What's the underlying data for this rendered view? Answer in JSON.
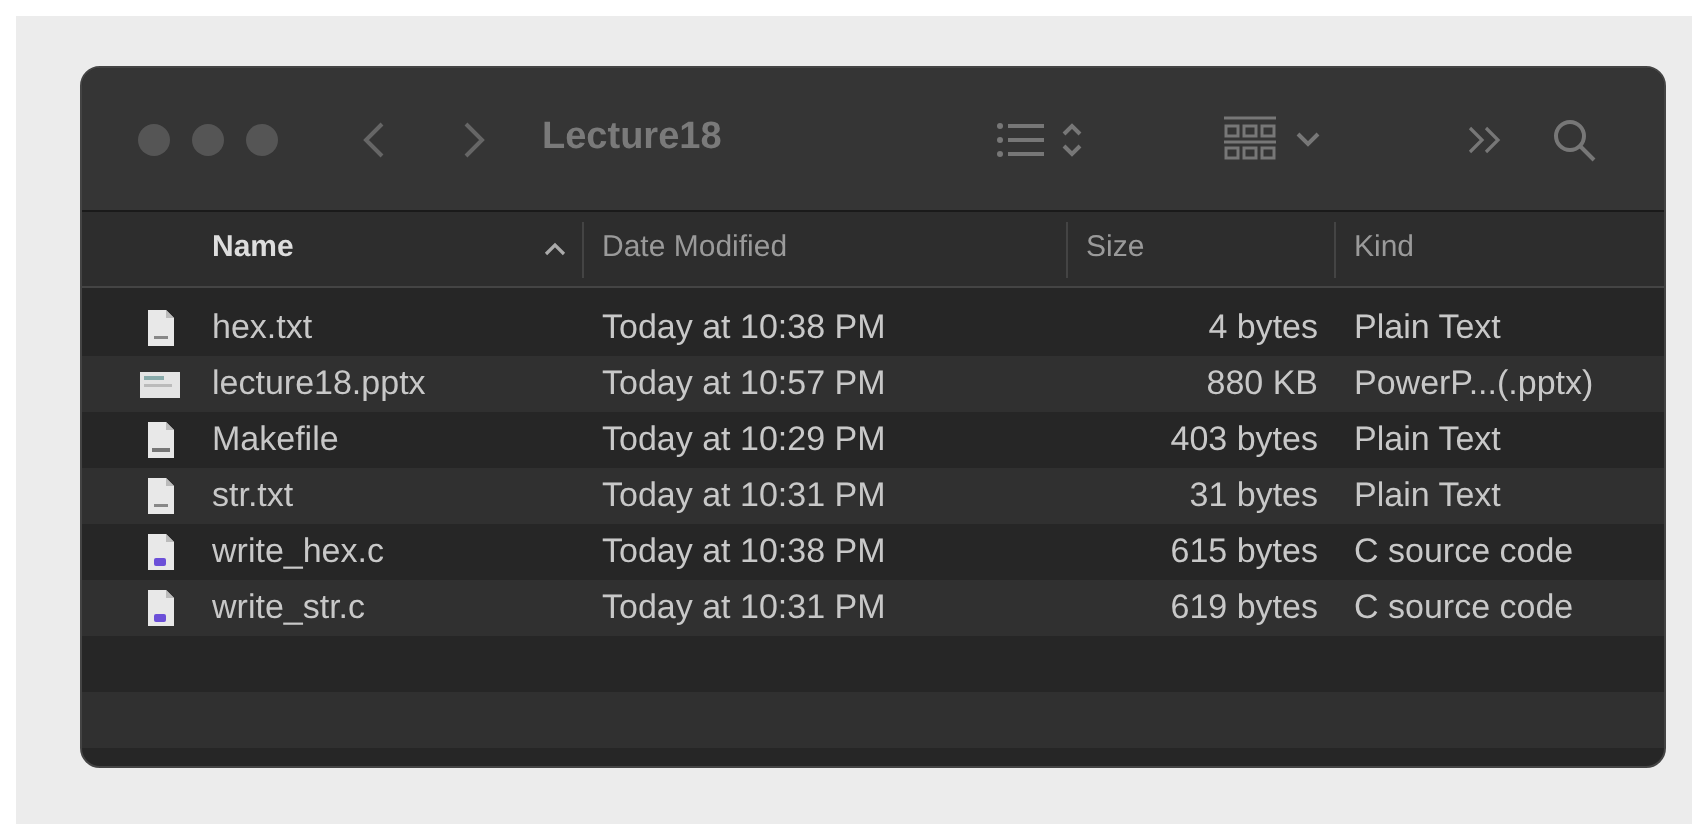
{
  "window": {
    "title": "Lecture18"
  },
  "table": {
    "columns": [
      {
        "label": "Name",
        "sorted": true
      },
      {
        "label": "Date Modified",
        "sorted": false
      },
      {
        "label": "Size",
        "sorted": false
      },
      {
        "label": "Kind",
        "sorted": false
      }
    ],
    "rows": [
      {
        "kind": "text",
        "name": "hex.txt",
        "date": "Today at 10:38 PM",
        "size": "4 bytes",
        "type": "Plain Text"
      },
      {
        "kind": "pptx",
        "name": "lecture18.pptx",
        "date": "Today at 10:57 PM",
        "size": "880 KB",
        "type": "PowerP...(.pptx)"
      },
      {
        "kind": "exec",
        "name": "Makefile",
        "date": "Today at 10:29 PM",
        "size": "403 bytes",
        "type": "Plain Text"
      },
      {
        "kind": "text",
        "name": "str.txt",
        "date": "Today at 10:31 PM",
        "size": "31 bytes",
        "type": "Plain Text"
      },
      {
        "kind": "c",
        "name": "write_hex.c",
        "date": "Today at 10:38 PM",
        "size": "615 bytes",
        "type": "C source code"
      },
      {
        "kind": "c",
        "name": "write_str.c",
        "date": "Today at 10:31 PM",
        "size": "619 bytes",
        "type": "C source code"
      }
    ]
  }
}
